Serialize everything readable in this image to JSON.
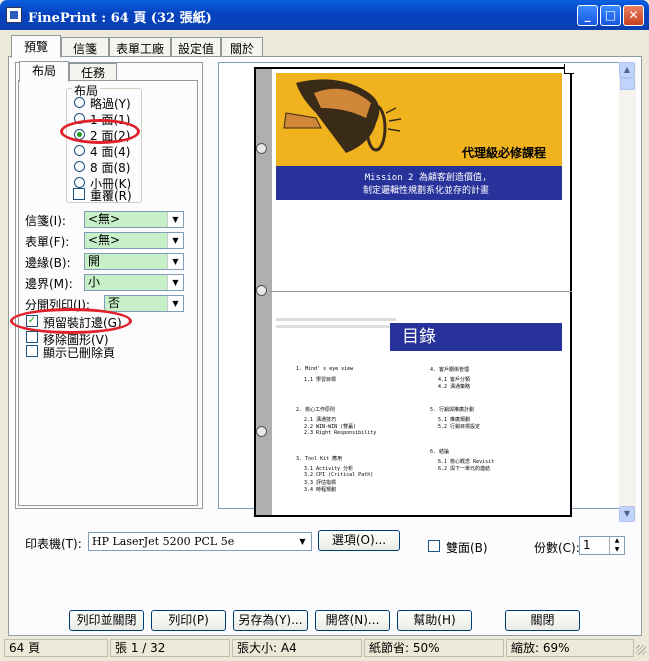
{
  "window": {
    "title": "FinePrint : 64 頁 (32 張紙)",
    "minimize": "_",
    "maximize": "□",
    "close": "✕"
  },
  "tabs": [
    "預覽",
    "信箋",
    "表單工廠",
    "設定值",
    "關於"
  ],
  "subtabs": [
    "布局",
    "任務"
  ],
  "layout_group": {
    "title": "布局",
    "options": [
      "略過(Y)",
      "1 面(1)",
      "2 面(2)",
      "4 面(4)",
      "8 面(8)",
      "小冊(K)"
    ],
    "selected": "2 面(2)",
    "repeat_label": "重覆(R)"
  },
  "fields": {
    "stationery_label": "信箋(I):",
    "stationery_value": "<無>",
    "form_label": "表單(F):",
    "form_value": "<無>",
    "border_label": "邊緣(B):",
    "border_value": "開",
    "margin_label": "邊界(M):",
    "margin_value": "小",
    "separate_label": "分開列印(J):",
    "separate_value": "否"
  },
  "checkboxes": {
    "gutter": {
      "label": "預留裝訂邊(G)",
      "checked": true
    },
    "remove_graphics": {
      "label": "移除圖形(V)",
      "checked": false
    },
    "show_deleted": {
      "label": "顯示已刪除頁",
      "checked": false
    }
  },
  "preview": {
    "course_title": "代理級必修課程",
    "mission_line1": "Mission 2  為顧客創造價值,",
    "mission_line2": "制定邏輯性規劃系化並存的計畫",
    "toc_title": "目錄",
    "toc_col1": [
      "1. Mind' s eye view",
      "1.1  學習目標",
      "2. 核心工作原則",
      "2.1  溝通技巧",
      "2.2  WIN-WIN (雙贏)",
      "2.3  Right Responsibility",
      "3. Tool Kit 應用",
      "3.1  Activity 分析",
      "3.2  CPI (Critical Path)",
      "3.3  評估指標",
      "3.4  時程規劃"
    ],
    "toc_col2": [
      "4. 客戶關係管理",
      "4.1  客戶分類",
      "4.2  溝通策略",
      "5. 行銷與推廣計劃",
      "5.1  推廣規劃",
      "5.2  行銷目標設定",
      "6. 結論",
      "6.1  核心概念 Revisit",
      "6.2  與下一單元的連結"
    ]
  },
  "printer": {
    "label": "印表機(T):",
    "value": "HP LaserJet 5200 PCL 5e",
    "options_button": "選項(O)...",
    "duplex_label": "雙面(B)",
    "copies_label": "份數(C):",
    "copies_value": "1"
  },
  "buttons": [
    "列印並關閉",
    "列印(P)",
    "另存為(Y)...",
    "開啓(N)...",
    "幫助(H)",
    "關閉"
  ],
  "status": [
    "64 頁",
    "張 1 / 32",
    "張大小: A4",
    "紙節省: 50%",
    "縮放: 69%"
  ]
}
